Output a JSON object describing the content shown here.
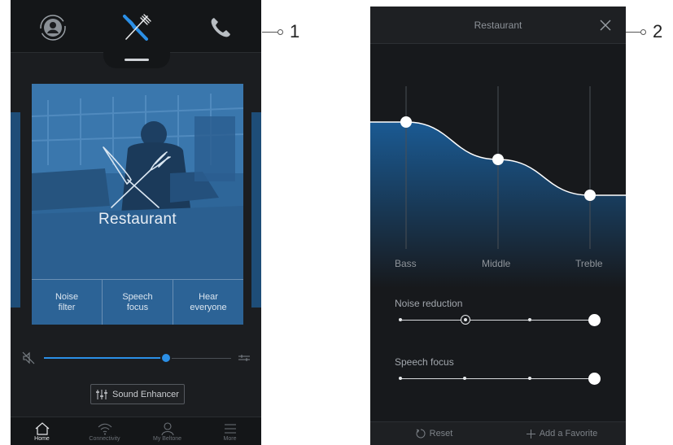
{
  "callouts": {
    "first": "1",
    "second": "2"
  },
  "screen1": {
    "top_bar": {
      "icons": [
        "profile-sync-icon",
        "restaurant-icon",
        "phone-icon"
      ],
      "accent": "#2b8fe6"
    },
    "program": {
      "title": "Restaurant",
      "modes": [
        {
          "line1": "Noise",
          "line2": "filter"
        },
        {
          "line1": "Speech",
          "line2": "focus"
        },
        {
          "line1": "Hear",
          "line2": "everyone"
        }
      ]
    },
    "volume": {
      "level": 0.65,
      "mute_icon": "speaker-mute-icon",
      "settings_icon": "sliders-icon"
    },
    "sound_enhancer_label": "Sound Enhancer",
    "tabs": [
      {
        "label": "Home",
        "icon": "home-icon",
        "active": true
      },
      {
        "label": "Connectivity",
        "icon": "wifi-icon",
        "active": false
      },
      {
        "label": "My Beltone",
        "icon": "user-icon",
        "active": false
      },
      {
        "label": "More",
        "icon": "menu-icon",
        "active": false
      }
    ]
  },
  "screen2": {
    "title": "Restaurant",
    "equalizer": {
      "bands": [
        "Bass",
        "Middle",
        "Treble"
      ],
      "levels": [
        0.78,
        0.55,
        0.33
      ]
    },
    "noise_reduction": {
      "label": "Noise reduction",
      "steps": 4,
      "value": 4,
      "marker_step": 2
    },
    "speech_focus": {
      "label": "Speech focus",
      "steps": 4,
      "value": 4
    },
    "footer": {
      "reset": "Reset",
      "favorite": "Add a Favorite"
    }
  }
}
